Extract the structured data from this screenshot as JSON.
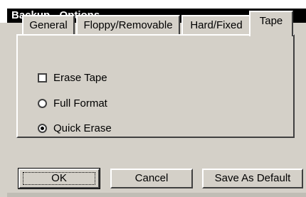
{
  "window": {
    "title": "Backup - Options"
  },
  "tabs": [
    {
      "label": "General"
    },
    {
      "label": "Floppy/Removable"
    },
    {
      "label": "Hard/Fixed"
    },
    {
      "label": "Tape",
      "active": true
    }
  ],
  "options": {
    "erase_tape": {
      "label": "Erase Tape",
      "checked": false
    },
    "full_format": {
      "label": "Full Format",
      "selected": false
    },
    "quick_erase": {
      "label": "Quick Erase",
      "selected": true
    }
  },
  "buttons": {
    "ok": "OK",
    "cancel": "Cancel",
    "save_default": "Save As Default"
  },
  "colors": {
    "face": "#d4d0c8",
    "title_bg": "#000000",
    "title_text": "#ffffff"
  }
}
